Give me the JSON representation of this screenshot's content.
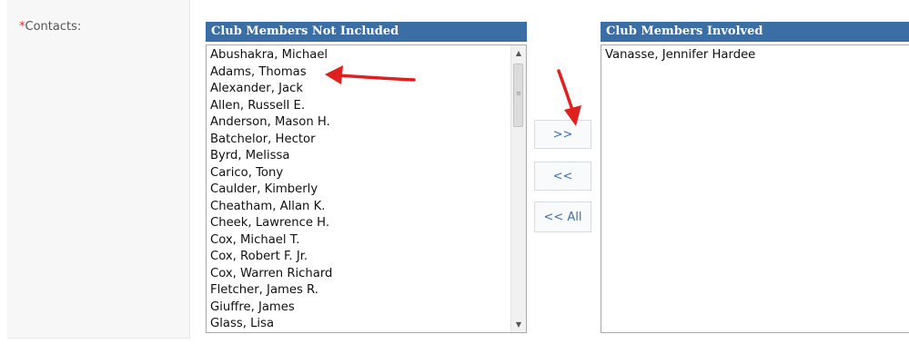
{
  "field": {
    "required_marker": "*",
    "label": "Contacts:"
  },
  "left_panel": {
    "header": "Club Members Not Included",
    "items": [
      "Abushakra, Michael",
      "Adams, Thomas",
      "Alexander, Jack",
      "Allen, Russell E.",
      "Anderson, Mason H.",
      "Batchelor, Hector",
      "Byrd, Melissa",
      "Carico, Tony",
      "Caulder, Kimberly",
      "Cheatham, Allan K.",
      "Cheek, Lawrence H.",
      "Cox, Michael T.",
      "Cox, Robert F. Jr.",
      "Cox, Warren Richard",
      "Fletcher, James R.",
      "Giuffre, James",
      "Glass, Lisa"
    ]
  },
  "right_panel": {
    "header": "Club Members Involved",
    "items": [
      "Vanasse, Jennifer Hardee"
    ]
  },
  "buttons": {
    "add": ">>",
    "remove": "<<",
    "remove_all": "<< All"
  },
  "icons": {
    "scroll_up": "triangle-up",
    "scroll_down": "triangle-down",
    "grip": "scroll-grip",
    "annotation": "red-arrow"
  },
  "colors": {
    "header_bg": "#3a6ea5",
    "required": "#e03030",
    "button_text": "#3d6fb0",
    "annotation": "#e02020"
  }
}
